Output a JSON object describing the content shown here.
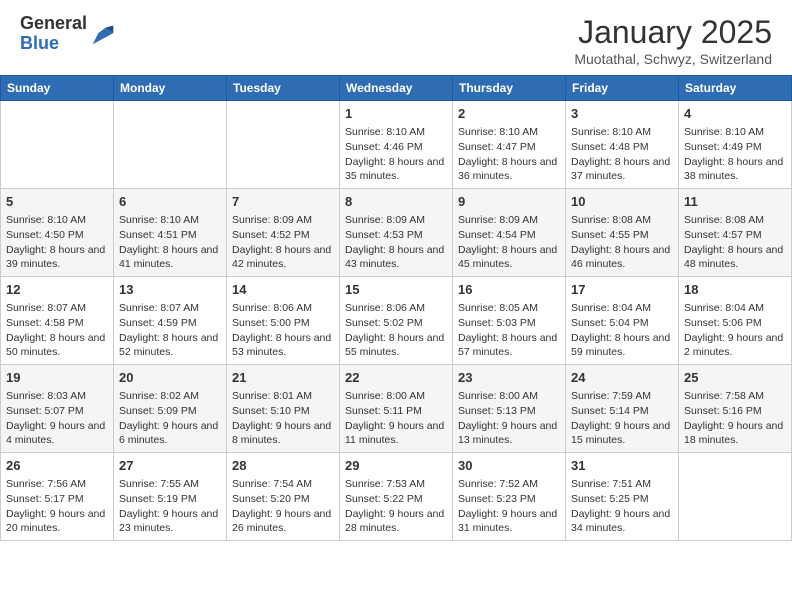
{
  "header": {
    "logo_general": "General",
    "logo_blue": "Blue",
    "month_title": "January 2025",
    "location": "Muotathal, Schwyz, Switzerland"
  },
  "days_of_week": [
    "Sunday",
    "Monday",
    "Tuesday",
    "Wednesday",
    "Thursday",
    "Friday",
    "Saturday"
  ],
  "weeks": [
    [
      {
        "day": "",
        "sunrise": "",
        "sunset": "",
        "daylight": ""
      },
      {
        "day": "",
        "sunrise": "",
        "sunset": "",
        "daylight": ""
      },
      {
        "day": "",
        "sunrise": "",
        "sunset": "",
        "daylight": ""
      },
      {
        "day": "1",
        "sunrise": "Sunrise: 8:10 AM",
        "sunset": "Sunset: 4:46 PM",
        "daylight": "Daylight: 8 hours and 35 minutes."
      },
      {
        "day": "2",
        "sunrise": "Sunrise: 8:10 AM",
        "sunset": "Sunset: 4:47 PM",
        "daylight": "Daylight: 8 hours and 36 minutes."
      },
      {
        "day": "3",
        "sunrise": "Sunrise: 8:10 AM",
        "sunset": "Sunset: 4:48 PM",
        "daylight": "Daylight: 8 hours and 37 minutes."
      },
      {
        "day": "4",
        "sunrise": "Sunrise: 8:10 AM",
        "sunset": "Sunset: 4:49 PM",
        "daylight": "Daylight: 8 hours and 38 minutes."
      }
    ],
    [
      {
        "day": "5",
        "sunrise": "Sunrise: 8:10 AM",
        "sunset": "Sunset: 4:50 PM",
        "daylight": "Daylight: 8 hours and 39 minutes."
      },
      {
        "day": "6",
        "sunrise": "Sunrise: 8:10 AM",
        "sunset": "Sunset: 4:51 PM",
        "daylight": "Daylight: 8 hours and 41 minutes."
      },
      {
        "day": "7",
        "sunrise": "Sunrise: 8:09 AM",
        "sunset": "Sunset: 4:52 PM",
        "daylight": "Daylight: 8 hours and 42 minutes."
      },
      {
        "day": "8",
        "sunrise": "Sunrise: 8:09 AM",
        "sunset": "Sunset: 4:53 PM",
        "daylight": "Daylight: 8 hours and 43 minutes."
      },
      {
        "day": "9",
        "sunrise": "Sunrise: 8:09 AM",
        "sunset": "Sunset: 4:54 PM",
        "daylight": "Daylight: 8 hours and 45 minutes."
      },
      {
        "day": "10",
        "sunrise": "Sunrise: 8:08 AM",
        "sunset": "Sunset: 4:55 PM",
        "daylight": "Daylight: 8 hours and 46 minutes."
      },
      {
        "day": "11",
        "sunrise": "Sunrise: 8:08 AM",
        "sunset": "Sunset: 4:57 PM",
        "daylight": "Daylight: 8 hours and 48 minutes."
      }
    ],
    [
      {
        "day": "12",
        "sunrise": "Sunrise: 8:07 AM",
        "sunset": "Sunset: 4:58 PM",
        "daylight": "Daylight: 8 hours and 50 minutes."
      },
      {
        "day": "13",
        "sunrise": "Sunrise: 8:07 AM",
        "sunset": "Sunset: 4:59 PM",
        "daylight": "Daylight: 8 hours and 52 minutes."
      },
      {
        "day": "14",
        "sunrise": "Sunrise: 8:06 AM",
        "sunset": "Sunset: 5:00 PM",
        "daylight": "Daylight: 8 hours and 53 minutes."
      },
      {
        "day": "15",
        "sunrise": "Sunrise: 8:06 AM",
        "sunset": "Sunset: 5:02 PM",
        "daylight": "Daylight: 8 hours and 55 minutes."
      },
      {
        "day": "16",
        "sunrise": "Sunrise: 8:05 AM",
        "sunset": "Sunset: 5:03 PM",
        "daylight": "Daylight: 8 hours and 57 minutes."
      },
      {
        "day": "17",
        "sunrise": "Sunrise: 8:04 AM",
        "sunset": "Sunset: 5:04 PM",
        "daylight": "Daylight: 8 hours and 59 minutes."
      },
      {
        "day": "18",
        "sunrise": "Sunrise: 8:04 AM",
        "sunset": "Sunset: 5:06 PM",
        "daylight": "Daylight: 9 hours and 2 minutes."
      }
    ],
    [
      {
        "day": "19",
        "sunrise": "Sunrise: 8:03 AM",
        "sunset": "Sunset: 5:07 PM",
        "daylight": "Daylight: 9 hours and 4 minutes."
      },
      {
        "day": "20",
        "sunrise": "Sunrise: 8:02 AM",
        "sunset": "Sunset: 5:09 PM",
        "daylight": "Daylight: 9 hours and 6 minutes."
      },
      {
        "day": "21",
        "sunrise": "Sunrise: 8:01 AM",
        "sunset": "Sunset: 5:10 PM",
        "daylight": "Daylight: 9 hours and 8 minutes."
      },
      {
        "day": "22",
        "sunrise": "Sunrise: 8:00 AM",
        "sunset": "Sunset: 5:11 PM",
        "daylight": "Daylight: 9 hours and 11 minutes."
      },
      {
        "day": "23",
        "sunrise": "Sunrise: 8:00 AM",
        "sunset": "Sunset: 5:13 PM",
        "daylight": "Daylight: 9 hours and 13 minutes."
      },
      {
        "day": "24",
        "sunrise": "Sunrise: 7:59 AM",
        "sunset": "Sunset: 5:14 PM",
        "daylight": "Daylight: 9 hours and 15 minutes."
      },
      {
        "day": "25",
        "sunrise": "Sunrise: 7:58 AM",
        "sunset": "Sunset: 5:16 PM",
        "daylight": "Daylight: 9 hours and 18 minutes."
      }
    ],
    [
      {
        "day": "26",
        "sunrise": "Sunrise: 7:56 AM",
        "sunset": "Sunset: 5:17 PM",
        "daylight": "Daylight: 9 hours and 20 minutes."
      },
      {
        "day": "27",
        "sunrise": "Sunrise: 7:55 AM",
        "sunset": "Sunset: 5:19 PM",
        "daylight": "Daylight: 9 hours and 23 minutes."
      },
      {
        "day": "28",
        "sunrise": "Sunrise: 7:54 AM",
        "sunset": "Sunset: 5:20 PM",
        "daylight": "Daylight: 9 hours and 26 minutes."
      },
      {
        "day": "29",
        "sunrise": "Sunrise: 7:53 AM",
        "sunset": "Sunset: 5:22 PM",
        "daylight": "Daylight: 9 hours and 28 minutes."
      },
      {
        "day": "30",
        "sunrise": "Sunrise: 7:52 AM",
        "sunset": "Sunset: 5:23 PM",
        "daylight": "Daylight: 9 hours and 31 minutes."
      },
      {
        "day": "31",
        "sunrise": "Sunrise: 7:51 AM",
        "sunset": "Sunset: 5:25 PM",
        "daylight": "Daylight: 9 hours and 34 minutes."
      },
      {
        "day": "",
        "sunrise": "",
        "sunset": "",
        "daylight": ""
      }
    ]
  ]
}
